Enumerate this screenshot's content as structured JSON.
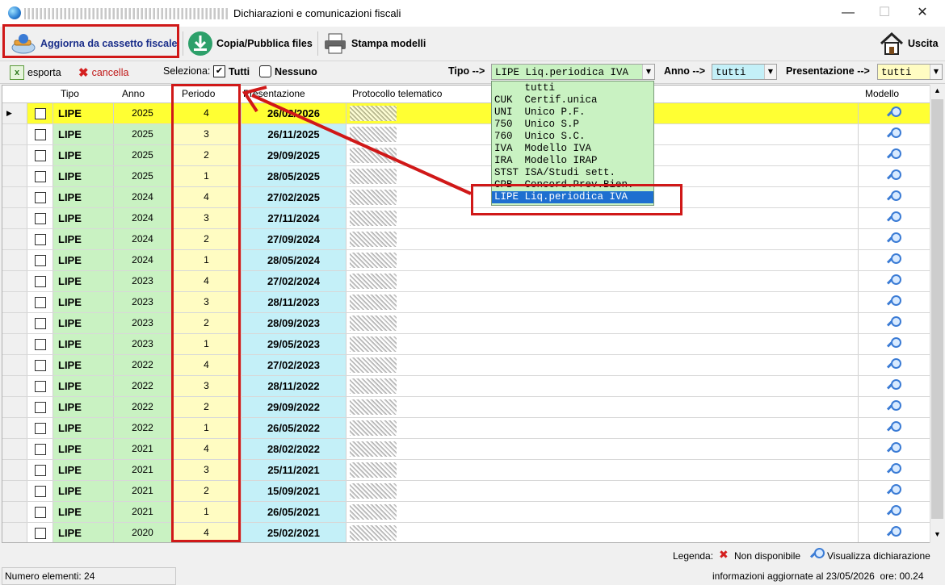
{
  "window": {
    "title": "Dichiarazioni e comunicazioni fiscali",
    "minimize": "—",
    "maximize": "☐",
    "close": "✕"
  },
  "toolbar": {
    "aggiorna": "Aggiorna da cassetto fiscale",
    "copia": "Copia/Pubblica files",
    "stampa": "Stampa modelli",
    "uscita": "Uscita"
  },
  "filters": {
    "esporta": "esporta",
    "cancella": "cancella",
    "seleziona": "Seleziona:",
    "tutti": "Tutti",
    "nessuno": "Nessuno",
    "tipo_label": "Tipo -->",
    "tipo_value": "LIPE Liq.periodica IVA",
    "anno_label": "Anno -->",
    "anno_value": "tutti",
    "presentazione_label": "Presentazione -->",
    "presentazione_value": "tutti"
  },
  "grid": {
    "columns": [
      "Tipo",
      "Anno",
      "Periodo",
      "Presentazione",
      "Protocollo telematico",
      "Modello"
    ],
    "rows": [
      {
        "tipo": "LIPE",
        "anno": "2025",
        "periodo": "4",
        "presentazione": "26/02/2026"
      },
      {
        "tipo": "LIPE",
        "anno": "2025",
        "periodo": "3",
        "presentazione": "26/11/2025"
      },
      {
        "tipo": "LIPE",
        "anno": "2025",
        "periodo": "2",
        "presentazione": "29/09/2025"
      },
      {
        "tipo": "LIPE",
        "anno": "2025",
        "periodo": "1",
        "presentazione": "28/05/2025"
      },
      {
        "tipo": "LIPE",
        "anno": "2024",
        "periodo": "4",
        "presentazione": "27/02/2025"
      },
      {
        "tipo": "LIPE",
        "anno": "2024",
        "periodo": "3",
        "presentazione": "27/11/2024"
      },
      {
        "tipo": "LIPE",
        "anno": "2024",
        "periodo": "2",
        "presentazione": "27/09/2024"
      },
      {
        "tipo": "LIPE",
        "anno": "2024",
        "periodo": "1",
        "presentazione": "28/05/2024"
      },
      {
        "tipo": "LIPE",
        "anno": "2023",
        "periodo": "4",
        "presentazione": "27/02/2024"
      },
      {
        "tipo": "LIPE",
        "anno": "2023",
        "periodo": "3",
        "presentazione": "28/11/2023"
      },
      {
        "tipo": "LIPE",
        "anno": "2023",
        "periodo": "2",
        "presentazione": "28/09/2023"
      },
      {
        "tipo": "LIPE",
        "anno": "2023",
        "periodo": "1",
        "presentazione": "29/05/2023"
      },
      {
        "tipo": "LIPE",
        "anno": "2022",
        "periodo": "4",
        "presentazione": "27/02/2023"
      },
      {
        "tipo": "LIPE",
        "anno": "2022",
        "periodo": "3",
        "presentazione": "28/11/2022"
      },
      {
        "tipo": "LIPE",
        "anno": "2022",
        "periodo": "2",
        "presentazione": "29/09/2022"
      },
      {
        "tipo": "LIPE",
        "anno": "2022",
        "periodo": "1",
        "presentazione": "26/05/2022"
      },
      {
        "tipo": "LIPE",
        "anno": "2021",
        "periodo": "4",
        "presentazione": "28/02/2022"
      },
      {
        "tipo": "LIPE",
        "anno": "2021",
        "periodo": "3",
        "presentazione": "25/11/2021"
      },
      {
        "tipo": "LIPE",
        "anno": "2021",
        "periodo": "2",
        "presentazione": "15/09/2021"
      },
      {
        "tipo": "LIPE",
        "anno": "2021",
        "periodo": "1",
        "presentazione": "26/05/2021"
      },
      {
        "tipo": "LIPE",
        "anno": "2020",
        "periodo": "4",
        "presentazione": "25/02/2021"
      }
    ]
  },
  "dropdown": {
    "items": [
      "     tutti",
      "CUK  Certif.unica",
      "UNI  Unico P.F.",
      "750  Unico S.P",
      "760  Unico S.C.",
      "IVA  Modello IVA",
      "IRA  Modello IRAP",
      "STST ISA/Studi sett.",
      "CPB  Concord.Prev.Bien.",
      "LIPE Liq.periodica IVA"
    ],
    "highlighted": 9
  },
  "legend": {
    "label": "Legenda:",
    "non_disponibile": "Non disponibile",
    "visualizza": "Visualizza dichiarazione"
  },
  "status": {
    "count": "Numero elementi: 24",
    "updated": "informazioni aggiornate al 23/05/2026  ore: 00.24"
  },
  "colors": {
    "highlight_red": "#d01818",
    "tipo_green": "#c9f2c2",
    "periodo_yellow": "#fffcc2",
    "presentazione_cyan": "#c4f0f8",
    "selected_row": "#ffff33"
  }
}
